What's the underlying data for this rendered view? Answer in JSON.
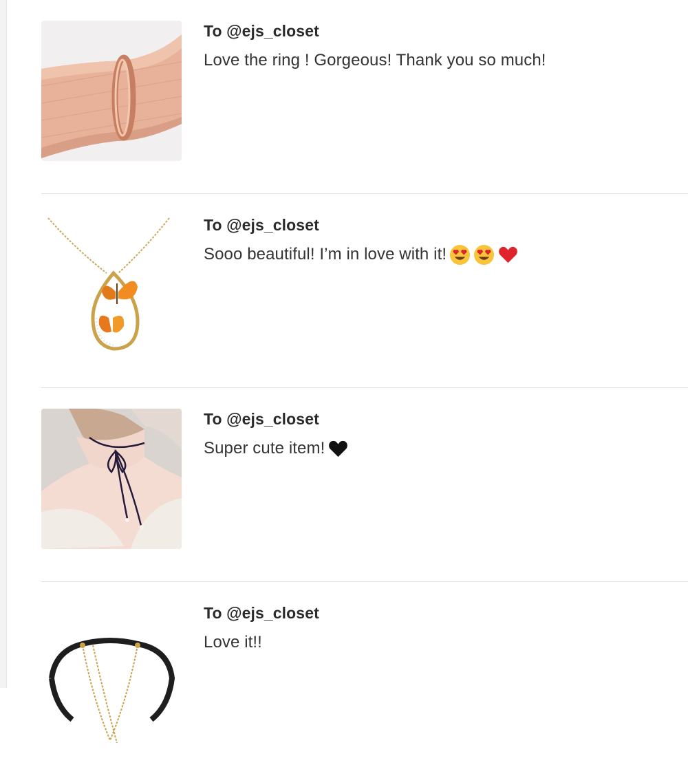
{
  "reviews": [
    {
      "recipient": "To @ejs_closet",
      "message": "Love the ring ! Gorgeous! Thank you so much!",
      "image_icon": "rose-gold-ring-on-ribbon",
      "emojis": []
    },
    {
      "recipient": "To @ejs_closet",
      "message": "Sooo beautiful! I’m in love with it!",
      "image_icon": "butterfly-pendant-necklace",
      "emojis": [
        "heart-eyes-emoji",
        "heart-eyes-emoji",
        "red-heart-emoji"
      ]
    },
    {
      "recipient": "To @ejs_closet",
      "message": "Super cute item!",
      "image_icon": "velvet-bow-choker",
      "emojis": [
        "black-heart-emoji"
      ]
    },
    {
      "recipient": "To @ejs_closet",
      "message": "Love it!!",
      "image_icon": "layered-choker-necklace",
      "emojis": []
    }
  ],
  "colors": {
    "text_primary": "#2b2b2b",
    "divider": "#e1e1e1",
    "ribbon": "#e8b29a",
    "ring_gold": "#d9967a",
    "heart_red": "#e0242b",
    "emoji_yellow": "#f7c43b"
  }
}
